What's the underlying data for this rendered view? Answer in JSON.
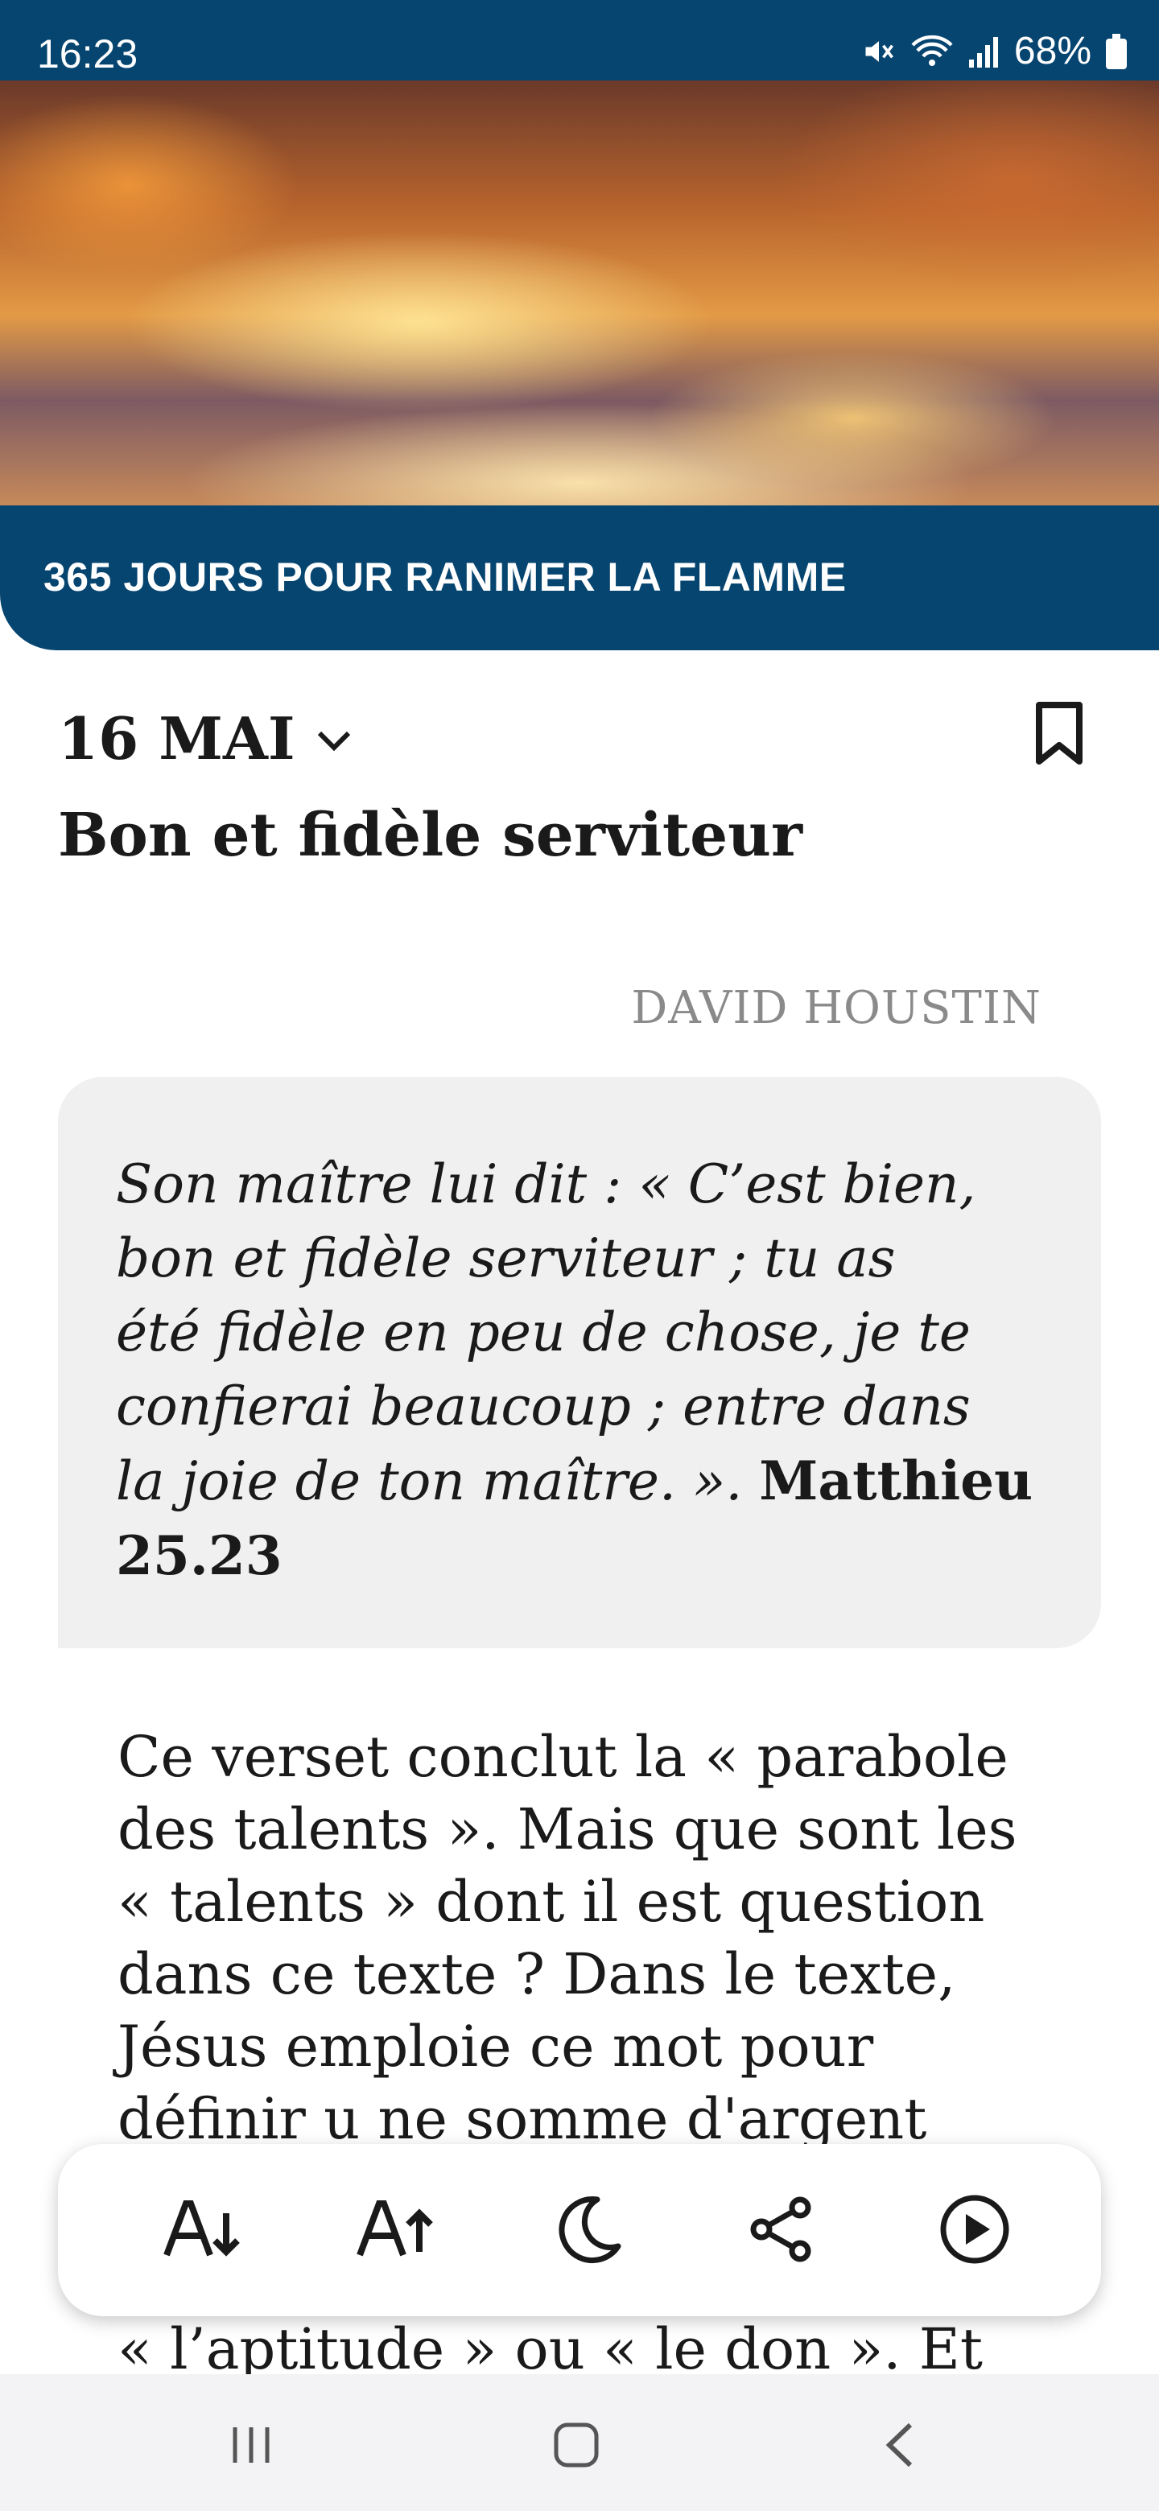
{
  "status_bar": {
    "time": "16:23",
    "battery": "68%"
  },
  "banner": {
    "title": "365 JOURS POUR RANIMER LA FLAMME"
  },
  "header": {
    "date": "16 MAI",
    "title": "Bon et fidèle serviteur"
  },
  "author": "DAVID HOUSTIN",
  "verse": {
    "line1": "Son maître lui dit : « C’est bien,",
    "line2": "bon et fidèle serviteur ; tu as",
    "line3": "été fidèle en peu de chose, je te",
    "line4": "confierai beaucoup ; entre dans",
    "line5": "la joie de ton maître. ».",
    "reference_part1": "Matthieu",
    "reference_part2": "25.23"
  },
  "body": {
    "line1": "Ce verset conclut la « parabole",
    "line2": "des talents ». Mais que sont les",
    "line3": "« talents » dont il est question",
    "line4": "dans ce texte ? Dans le texte,",
    "line5": "Jésus emploie ce mot pour",
    "line6": "définir u ne somme d'argent",
    "line_after_toolbar": "« l’aptitude » ou « le don ». Et"
  },
  "toolbar": {
    "icons": [
      "font-decrease-icon",
      "font-increase-icon",
      "moon-icon",
      "share-icon",
      "play-icon"
    ]
  },
  "nav": {
    "icons": [
      "recent-apps-icon",
      "home-icon",
      "back-icon"
    ]
  },
  "colors": {
    "brand_blue": "#064570",
    "quote_background": "#f0f0f0",
    "author_gray": "#8a8a8a"
  }
}
